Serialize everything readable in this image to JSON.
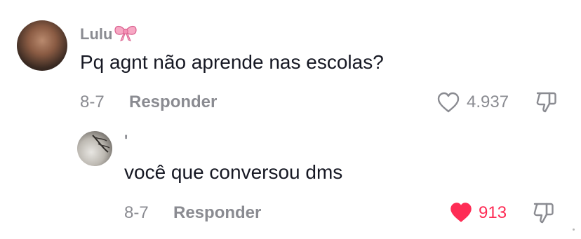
{
  "comment": {
    "username": "Lulu",
    "text": "Pq agnt não aprende nas escolas?",
    "date": "8-7",
    "reply_label": "Responder",
    "likes": "4.937",
    "liked": false
  },
  "reply": {
    "username": "'",
    "text": "você que conversou dms",
    "date": "8-7",
    "reply_label": "Responder",
    "likes": "913",
    "liked": true
  },
  "icons": {
    "like": "heart-icon",
    "dislike": "thumbs-down-icon",
    "username_decoration": "bow-emoji"
  },
  "colors": {
    "liked": "#fe2c55",
    "muted": "#8a8b91",
    "text": "#161823"
  }
}
